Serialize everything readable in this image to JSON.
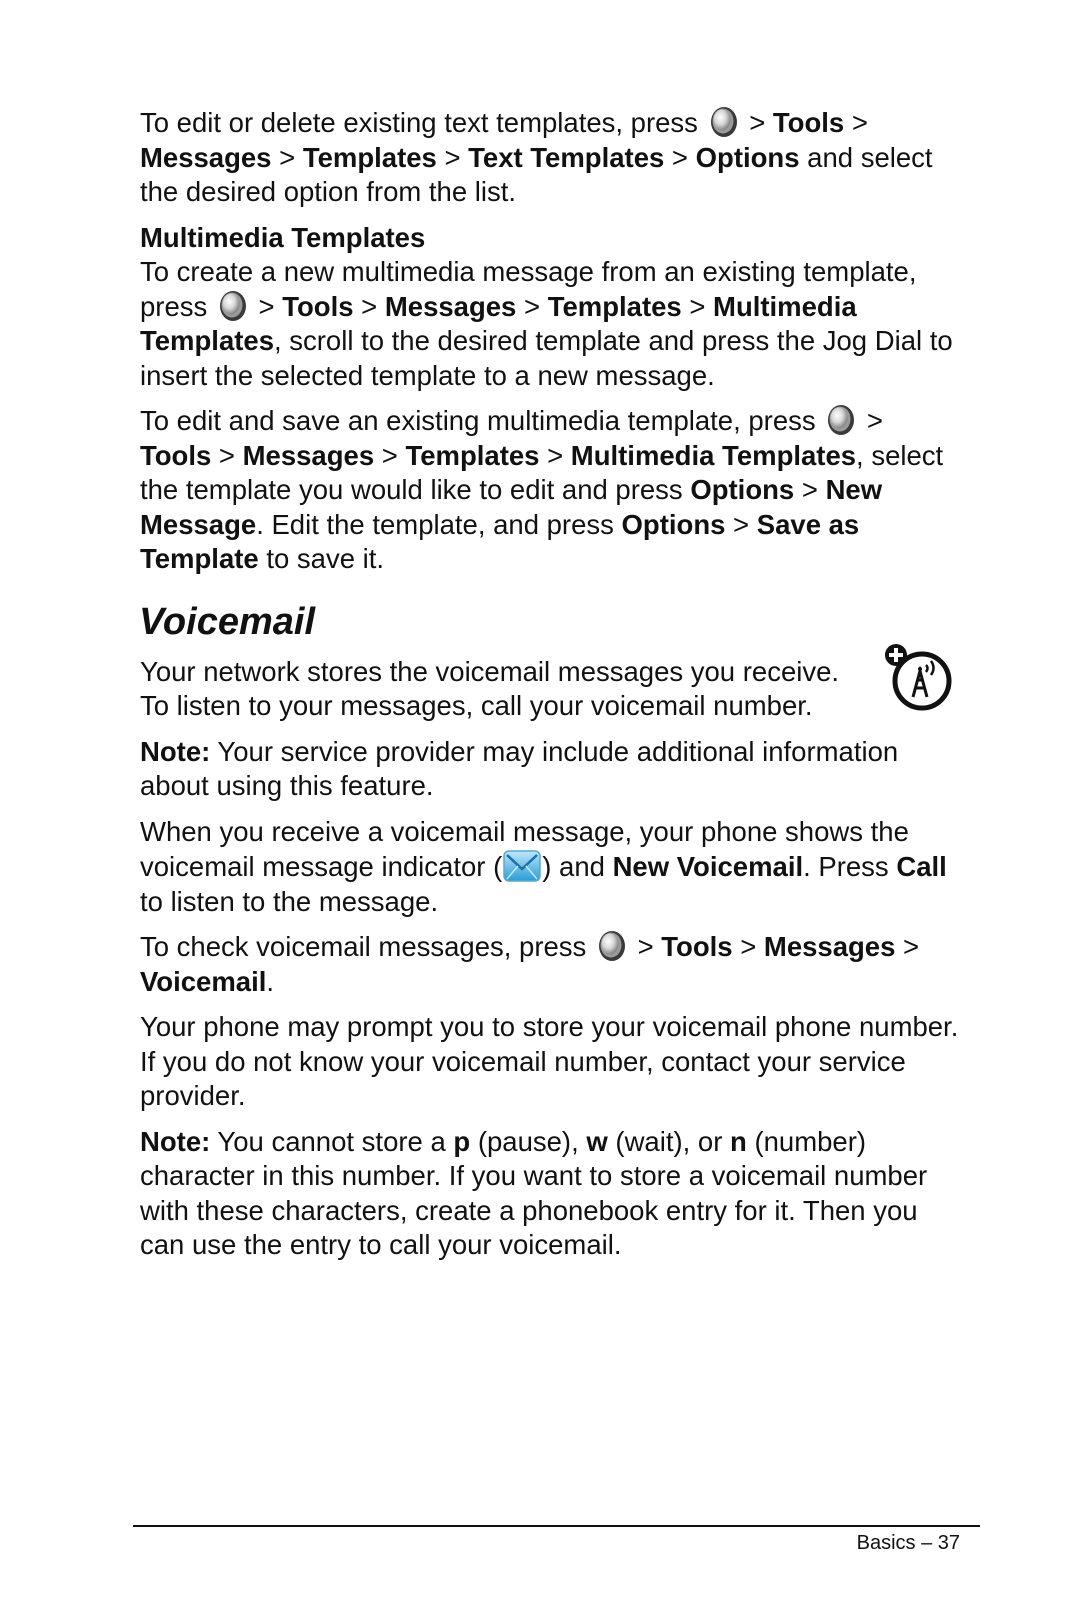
{
  "page": {
    "para1": {
      "t1": "To edit or delete existing text templates, press ",
      "sep": " > ",
      "b1": "Tools",
      "b2": "Messages",
      "b3": "Templates",
      "b4": "Text Templates",
      "b5": "Options",
      "t2": " and select the desired option from the list."
    },
    "subheading": "Multimedia Templates",
    "para2": {
      "t1": "To create a new multimedia message from an existing template, press ",
      "b1": "Tools",
      "b2": "Messages",
      "b3": "Templates",
      "b4": "Multimedia Templates",
      "t2": ", scroll to the desired template and press the Jog Dial to insert the selected template to a new message."
    },
    "para3": {
      "t1": "To edit and save an existing multimedia template, press ",
      "b1": "Tools",
      "b2": "Messages",
      "b3": "Templates",
      "b4": "Multimedia Templates",
      "t2": ", select the template you would like to edit and press ",
      "b5": "Options",
      "b6": "New Message",
      "t3": ". Edit the template, and press ",
      "b7": "Options",
      "b8": "Save as Template",
      "t4": " to save it."
    },
    "section_title": "Voicemail",
    "para4": "Your network stores the voicemail messages you receive. To listen to your messages, call your voicemail number.",
    "para5": {
      "b1": "Note:",
      "t1": " Your service provider may include additional information about using this feature."
    },
    "para6": {
      "t1": "When you receive a voicemail message, your phone shows the voicemail message indicator (",
      "t2": ") and ",
      "b1": "New Voicemail",
      "t3": ". Press ",
      "b2": "Call",
      "t4": " to listen to the message."
    },
    "para7": {
      "t1": "To check voicemail messages, press ",
      "b1": "Tools",
      "b2": "Messages",
      "b3": "Voicemail",
      "t2": "."
    },
    "para8": "Your phone may prompt you to store your voicemail phone number. If you do not know your voicemail number, contact your service provider.",
    "para9": {
      "b1": "Note:",
      "t1": " You cannot store a ",
      "b2": "p",
      "t2": " (pause), ",
      "b3": "w",
      "t3": " (wait), or ",
      "b4": "n",
      "t4": " (number) character in this number. If you want to store a voicemail number with these characters, create a phonebook entry for it. Then you can use the entry to call your voicemail."
    },
    "icons": {
      "menu_key": "menu-key-icon",
      "network_feature": "network-feature-icon",
      "voicemail_indicator": "envelope-icon"
    }
  },
  "footer": {
    "label": "Basics – 37"
  }
}
